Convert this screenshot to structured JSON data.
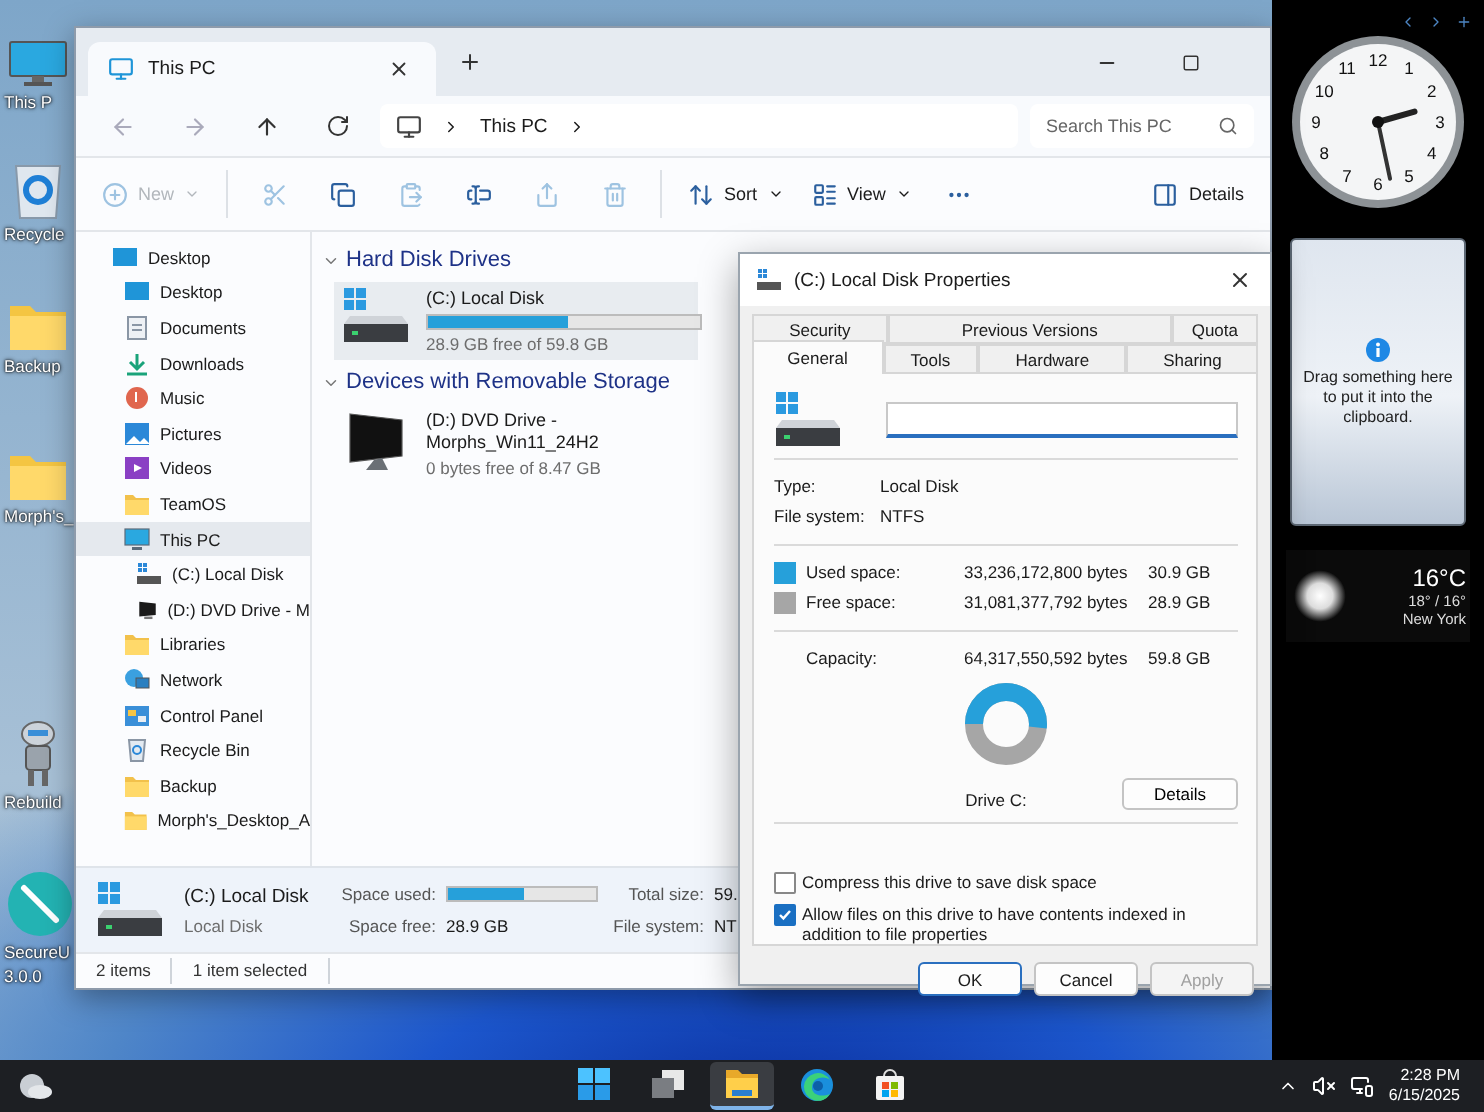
{
  "desktop_icons": [
    {
      "kind": "pc",
      "label": "This P"
    },
    {
      "kind": "recycle",
      "label": "Recycle"
    },
    {
      "kind": "folder",
      "label": "Backup"
    },
    {
      "kind": "folder",
      "label": "Morph's_"
    },
    {
      "kind": "robot",
      "label": "Rebuild"
    },
    {
      "kind": "brush",
      "label": "SecureU",
      "sublabel": "3.0.0"
    }
  ],
  "explorer": {
    "tabs": [
      {
        "title": "This PC",
        "selected": true
      }
    ],
    "address": {
      "path": [
        "This PC"
      ]
    },
    "search": {
      "placeholder": "Search This PC"
    },
    "toolbar": [
      {
        "kind": "new",
        "label": "New",
        "disabled": true
      },
      {
        "kind": "cut",
        "disabled": true
      },
      {
        "kind": "copy",
        "disabled": false
      },
      {
        "kind": "paste",
        "disabled": true
      },
      {
        "kind": "rename",
        "disabled": false
      },
      {
        "kind": "share",
        "disabled": true
      },
      {
        "kind": "delete",
        "disabled": true
      },
      {
        "kind": "sort",
        "label": "Sort",
        "disabled": false
      },
      {
        "kind": "view",
        "label": "View",
        "disabled": false
      },
      {
        "kind": "more",
        "disabled": false
      },
      {
        "kind": "details",
        "label": "Details",
        "disabled": false
      }
    ],
    "sidebar": [
      {
        "label": "Desktop",
        "kind": "desktop",
        "selected": false,
        "children": [
          {
            "label": "Desktop",
            "kind": "desktop",
            "selected": false
          },
          {
            "label": "Documents",
            "kind": "documents",
            "selected": false
          },
          {
            "label": "Downloads",
            "kind": "downloads",
            "selected": false
          },
          {
            "label": "Music",
            "kind": "music",
            "selected": false
          },
          {
            "label": "Pictures",
            "kind": "pictures",
            "selected": false
          },
          {
            "label": "Videos",
            "kind": "videos",
            "selected": false
          },
          {
            "label": "TeamOS",
            "kind": "folder",
            "selected": false
          },
          {
            "label": "This PC",
            "kind": "pc",
            "selected": true,
            "children": [
              {
                "label": "(C:) Local Disk",
                "kind": "disk",
                "selected": false
              },
              {
                "label": "(D:) DVD Drive - M",
                "kind": "dvd",
                "selected": false
              }
            ]
          },
          {
            "label": "Libraries",
            "kind": "folder",
            "selected": false
          },
          {
            "label": "Network",
            "kind": "network",
            "selected": false
          },
          {
            "label": "Control Panel",
            "kind": "control",
            "selected": false
          },
          {
            "label": "Recycle Bin",
            "kind": "recycle",
            "selected": false
          },
          {
            "label": "Backup",
            "kind": "folder",
            "selected": false
          },
          {
            "label": "Morph's_Desktop_A",
            "kind": "folder",
            "selected": false
          }
        ]
      }
    ],
    "sections": [
      {
        "title": "Hard Disk Drives",
        "expanded": true,
        "drives": [
          {
            "kind": "disk",
            "name": "(C:) Local Disk",
            "level": 0.517,
            "free": "28.9 GB free of 59.8 GB",
            "selected": true
          }
        ]
      },
      {
        "title": "Devices with Removable Storage",
        "expanded": true,
        "drives": [
          {
            "kind": "dvd",
            "name": "(D:) DVD Drive - Morphs_Win11_24H2",
            "free": "0 bytes free of 8.47 GB",
            "selected": false
          }
        ]
      }
    ],
    "details_pane": {
      "title": "(C:) Local Disk",
      "subtitle": "Local Disk",
      "fields": [
        {
          "label": "Space used:",
          "kind": "bar",
          "level": 0.517
        },
        {
          "label": "Total size:",
          "kind": "text",
          "value": "59."
        },
        {
          "label": "Space free:",
          "kind": "text",
          "value": "28.9 GB"
        },
        {
          "label": "File system:",
          "kind": "text",
          "value": "NT"
        }
      ]
    },
    "status_bar": [
      "2 items",
      "1 item selected"
    ]
  },
  "properties": {
    "title": "(C:) Local Disk Properties",
    "tab_rows": [
      {
        "tabs": [
          {
            "label": "Security",
            "selected": false
          },
          {
            "label": "Previous Versions",
            "selected": false
          },
          {
            "label": "Quota",
            "selected": false
          }
        ]
      },
      {
        "tabs": [
          {
            "label": "General",
            "selected": true
          },
          {
            "label": "Tools",
            "selected": false
          },
          {
            "label": "Hardware",
            "selected": false
          },
          {
            "label": "Sharing",
            "selected": false
          }
        ]
      }
    ],
    "info": [
      {
        "label": "Type:",
        "value": "Local Disk"
      },
      {
        "label": "File system:",
        "value": "NTFS"
      }
    ],
    "space": [
      {
        "label": "Used space:",
        "bytes": "33,236,172,800 bytes",
        "size": "30.9 GB",
        "color": "#26a0da"
      },
      {
        "label": "Free space:",
        "bytes": "31,081,377,792 bytes",
        "size": "28.9 GB",
        "color": "#a6a6a6"
      }
    ],
    "capacity": {
      "label": "Capacity:",
      "bytes": "64,317,550,592 bytes",
      "size": "59.8 GB"
    },
    "ring": {
      "level": 0.517
    },
    "drive_label": "Drive C:",
    "details_button": "Details",
    "options": [
      {
        "label": "Compress this drive to save disk space",
        "checked": false
      },
      {
        "label": "Allow files on this drive to have contents indexed in addition to file properties",
        "checked": true
      }
    ],
    "buttons": [
      {
        "label": "OK",
        "kind": "default"
      },
      {
        "label": "Cancel",
        "kind": "normal"
      },
      {
        "label": "Apply",
        "kind": "disabled"
      }
    ]
  },
  "gadgets": {
    "clock": {
      "numerals": [
        "12",
        "1",
        "2",
        "3",
        "4",
        "5",
        "6",
        "7",
        "8",
        "9",
        "10",
        "11"
      ]
    },
    "clipboard": {
      "text": "Drag something here to put it into the clipboard."
    },
    "weather": {
      "temp": "16°C",
      "range": "18° / 16°",
      "city": "New York"
    }
  },
  "taskbar": {
    "apps": [
      {
        "kind": "start",
        "active": false
      },
      {
        "kind": "taskview",
        "active": false
      },
      {
        "kind": "explorer",
        "active": true
      },
      {
        "kind": "edge",
        "active": false
      },
      {
        "kind": "store",
        "active": false
      }
    ],
    "time": "2:28 PM",
    "date": "6/15/2025"
  }
}
